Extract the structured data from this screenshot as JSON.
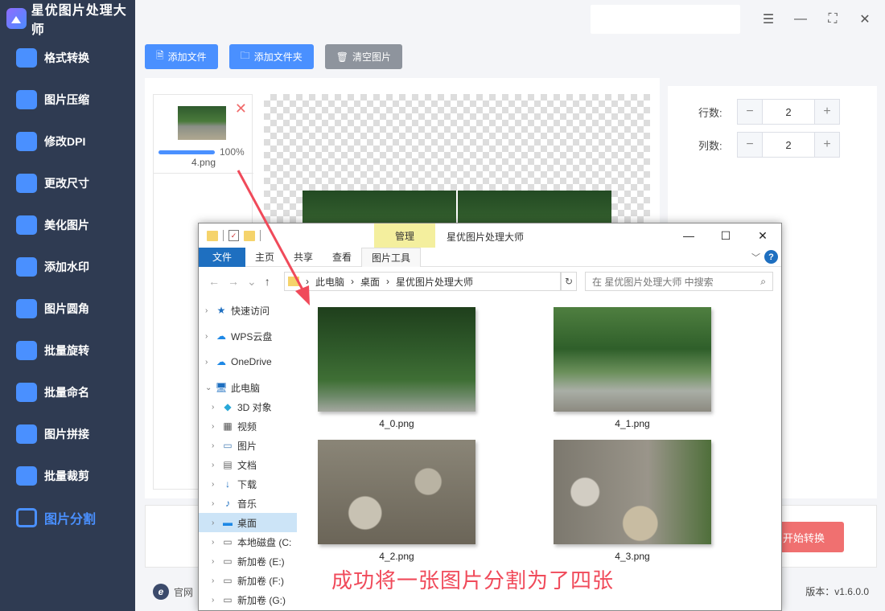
{
  "app": {
    "title": "星优图片处理大师"
  },
  "sidebar": {
    "items": [
      {
        "label": "格式转换",
        "icon": "image-convert-icon"
      },
      {
        "label": "图片压缩",
        "icon": "image-compress-icon"
      },
      {
        "label": "修改DPI",
        "icon": "dpi-icon"
      },
      {
        "label": "更改尺寸",
        "icon": "resize-icon"
      },
      {
        "label": "美化图片",
        "icon": "beautify-icon"
      },
      {
        "label": "添加水印",
        "icon": "watermark-icon"
      },
      {
        "label": "图片圆角",
        "icon": "round-corner-icon"
      },
      {
        "label": "批量旋转",
        "icon": "rotate-icon"
      },
      {
        "label": "批量命名",
        "icon": "rename-icon"
      },
      {
        "label": "图片拼接",
        "icon": "stitch-icon"
      },
      {
        "label": "批量裁剪",
        "icon": "crop-icon"
      },
      {
        "label": "图片分割",
        "icon": "split-icon"
      }
    ],
    "active_index": 11
  },
  "toolbar": {
    "add_file": "添加文件",
    "add_folder": "添加文件夹",
    "clear": "清空图片"
  },
  "file_list": [
    {
      "name": "4.png",
      "progress_percent": 100,
      "progress_label": "100%"
    }
  ],
  "settings": {
    "rows_label": "行数:",
    "rows_value": "2",
    "cols_label": "列数:",
    "cols_value": "2",
    "minus": "−",
    "plus": "+"
  },
  "bottom": {
    "start_button": "开始转换",
    "website": "官网",
    "version": "版本：v1.6.0.0"
  },
  "explorer": {
    "manage_tab": "管理",
    "window_title": "星优图片处理大师",
    "ribbon": [
      "文件",
      "主页",
      "共享",
      "查看",
      "图片工具"
    ],
    "breadcrumb": [
      "此电脑",
      "桌面",
      "星优图片处理大师"
    ],
    "search_placeholder": "在 星优图片处理大师 中搜索",
    "nav_pane": [
      {
        "label": "快速访问",
        "icon": "star-icon",
        "level": 0
      },
      {
        "label": "WPS云盘",
        "icon": "cloud-icon",
        "level": 0
      },
      {
        "label": "OneDrive",
        "icon": "cloud-icon",
        "level": 0
      },
      {
        "label": "此电脑",
        "icon": "computer-icon",
        "level": 0,
        "expanded": true
      },
      {
        "label": "3D 对象",
        "icon": "cube-icon",
        "level": 1
      },
      {
        "label": "视频",
        "icon": "video-icon",
        "level": 1
      },
      {
        "label": "图片",
        "icon": "picture-icon",
        "level": 1
      },
      {
        "label": "文档",
        "icon": "document-icon",
        "level": 1
      },
      {
        "label": "下载",
        "icon": "download-icon",
        "level": 1
      },
      {
        "label": "音乐",
        "icon": "music-icon",
        "level": 1
      },
      {
        "label": "桌面",
        "icon": "desktop-icon",
        "level": 1,
        "selected": true
      },
      {
        "label": "本地磁盘 (C:",
        "icon": "drive-icon",
        "level": 1
      },
      {
        "label": "新加卷 (E:)",
        "icon": "drive-icon",
        "level": 1
      },
      {
        "label": "新加卷 (F:)",
        "icon": "drive-icon",
        "level": 1
      },
      {
        "label": "新加卷 (G:)",
        "icon": "drive-icon",
        "level": 1
      }
    ],
    "files": [
      "4_0.png",
      "4_1.png",
      "4_2.png",
      "4_3.png"
    ]
  },
  "annotation": {
    "caption": "成功将一张图片分割为了四张",
    "color": "#f04a5a"
  }
}
